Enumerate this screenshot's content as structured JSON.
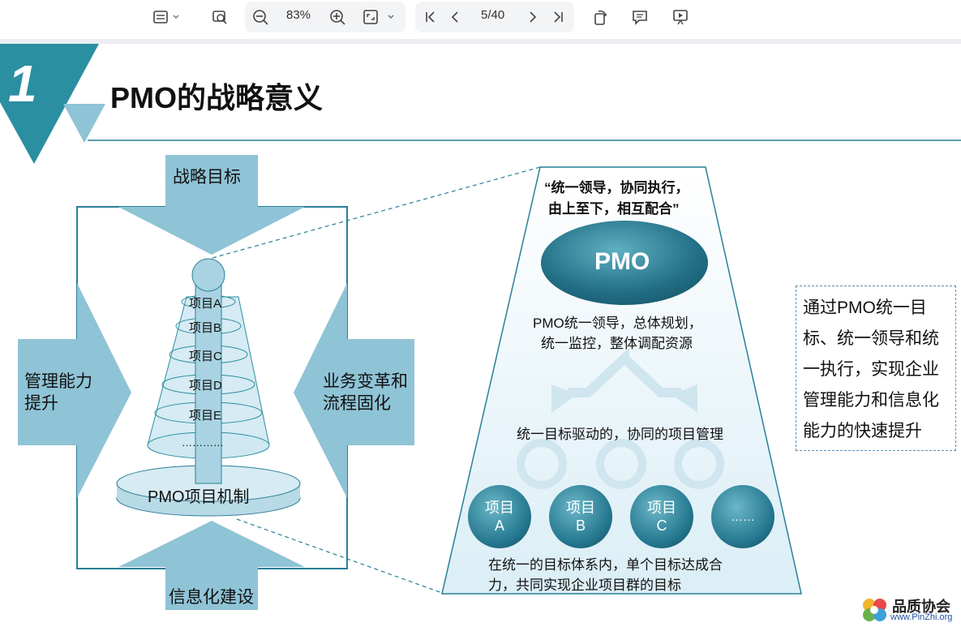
{
  "toolbar": {
    "zoom": "83%",
    "page": "5/40"
  },
  "slide": {
    "number": "1",
    "title": "PMO的战略意义",
    "left_diagram": {
      "top_arrow": "战略目标",
      "bottom_arrow": "信息化建设",
      "left_arrow_line1": "管理能力",
      "left_arrow_line2": "提升",
      "right_arrow_line1": "业务变革和",
      "right_arrow_line2": "流程固化",
      "tiers": [
        "项目A",
        "项目B",
        "项目C",
        "项目D",
        "项目E",
        "…………"
      ],
      "base": "PMO项目机制"
    },
    "right_diagram": {
      "quote_line1": "“统一领导，协同执行，",
      "quote_line2": "由上至下，相互配合”",
      "pmo": "PMO",
      "pmo_desc_line1": "PMO统一领导，总体规划，",
      "pmo_desc_line2": "统一监控，整体调配资源",
      "middle_text": "统一目标驱动的，协同的项目管理",
      "projects": [
        {
          "line1": "项目",
          "line2": "A"
        },
        {
          "line1": "项目",
          "line2": "B"
        },
        {
          "line1": "项目",
          "line2": "C"
        },
        {
          "line1": "……",
          "line2": ""
        }
      ],
      "bottom_line1": "在统一的目标体系内，单个目标达成合",
      "bottom_line2": "力，共同实现企业项目群的目标"
    },
    "summary_lines": [
      "通过PMO统一目",
      "标、统一领导和统",
      "一执行，实现企业",
      "管理能力和信息化",
      "能力的快速提升"
    ],
    "logo": {
      "name": "品质协会",
      "url": "www.PinZhi.org"
    }
  },
  "colors": {
    "teal": "#2a8fa0",
    "light_blue": "#8fc3d6",
    "dark_teal": "#1f6f84"
  }
}
